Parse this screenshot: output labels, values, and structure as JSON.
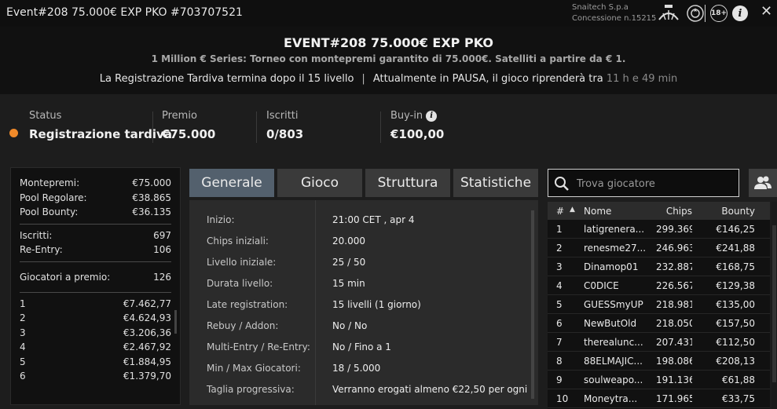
{
  "window": {
    "title": "Event#208 75.000€ EXP PKO #703707521",
    "brand_line1": "Snaitech S.p.a",
    "brand_line2": "Concessione n.15215",
    "age_badge": "18+",
    "close_glyph": "✕",
    "icons": [
      "adm-logo-icon",
      "emblem-icon",
      "age-18-icon",
      "info-icon",
      "close-icon"
    ]
  },
  "event": {
    "title": "EVENT#208 75.000€ EXP PKO",
    "subtitle": "1 Million € Series: Torneo con montepremi garantito di 75.000€. Satelliti a partire da € 1.",
    "info_left": "La Registrazione Tardiva termina dopo il 15 livello",
    "info_sep": "|",
    "info_right": "Attualmente in PAUSA, il gioco riprenderà tra",
    "info_time": "11 h e 49 min"
  },
  "stats": {
    "status_label": "Status",
    "status_value": "Registrazione tardiva",
    "status_color": "#f08a2a",
    "prize_label": "Premio",
    "prize_value": "€75.000",
    "registered_label": "Iscritti",
    "registered_value": "0/803",
    "buyin_label": "Buy-in",
    "buyin_value": "€100,00"
  },
  "summary": {
    "prize_pool_label": "Montepremi:",
    "prize_pool_value": "€75.000",
    "regular_label": "Pool Regolare:",
    "regular_value": "€38.865",
    "bounty_label": "Pool Bounty:",
    "bounty_value": "€36.135",
    "entrants_label": "Iscritti:",
    "entrants_value": "697",
    "reentry_label": "Re-Entry:",
    "reentry_value": "106",
    "paid_label": "Giocatori a premio:",
    "paid_value": "126",
    "payouts": [
      {
        "place": "1",
        "amount": "€7.462,77"
      },
      {
        "place": "2",
        "amount": "€4.624,93"
      },
      {
        "place": "3",
        "amount": "€3.206,36"
      },
      {
        "place": "4",
        "amount": "€2.467,92"
      },
      {
        "place": "5",
        "amount": "€1.884,95"
      },
      {
        "place": "6",
        "amount": "€1.379,70"
      }
    ]
  },
  "tabs": [
    {
      "label": "Generale",
      "active": true
    },
    {
      "label": "Gioco",
      "active": false
    },
    {
      "label": "Struttura",
      "active": false
    },
    {
      "label": "Statistiche",
      "active": false
    }
  ],
  "general": [
    {
      "key": "Inizio:",
      "value": "21:00 CET , apr 4"
    },
    {
      "key": "Chips iniziali:",
      "value": "20.000"
    },
    {
      "key": "Livello iniziale:",
      "value": "25 / 50"
    },
    {
      "key": "Durata livello:",
      "value": "15 min"
    },
    {
      "key": "Late registration:",
      "value": "15 livelli (1 giorno)"
    },
    {
      "key": "Rebuy / Addon:",
      "value": "No / No"
    },
    {
      "key": "Multi-Entry / Re-Entry:",
      "value": "No / Fino a 1"
    },
    {
      "key": "Min / Max Giocatori:",
      "value": "18 / 5.000"
    },
    {
      "key": "Taglia progressiva:",
      "value": "Verranno erogati almeno €22,50 per ogni"
    }
  ],
  "search": {
    "placeholder": "Trova giocatore"
  },
  "players": {
    "headers": {
      "num": "#",
      "sort_arrow": "▲",
      "name": "Nome",
      "chips": "Chips",
      "bounty": "Bounty"
    },
    "rows": [
      {
        "num": "1",
        "name": "latigrenera...",
        "chips": "299.369",
        "bounty": "€146,25"
      },
      {
        "num": "2",
        "name": "renesme27...",
        "chips": "246.963",
        "bounty": "€241,88"
      },
      {
        "num": "3",
        "name": "Dinamop01",
        "chips": "232.887",
        "bounty": "€168,75"
      },
      {
        "num": "4",
        "name": "C0DICE",
        "chips": "226.567",
        "bounty": "€129,38"
      },
      {
        "num": "5",
        "name": "GUESSmyUP",
        "chips": "218.981",
        "bounty": "€135,00"
      },
      {
        "num": "6",
        "name": "NewButOld",
        "chips": "218.050",
        "bounty": "€157,50"
      },
      {
        "num": "7",
        "name": "therealunc...",
        "chips": "207.431",
        "bounty": "€112,50"
      },
      {
        "num": "8",
        "name": "88ELMAJIC...",
        "chips": "198.086",
        "bounty": "€208,13"
      },
      {
        "num": "9",
        "name": "soulweapo...",
        "chips": "191.136",
        "bounty": "€61,88"
      },
      {
        "num": "10",
        "name": "Moneytra...",
        "chips": "171.965",
        "bounty": "€33,75"
      }
    ]
  }
}
